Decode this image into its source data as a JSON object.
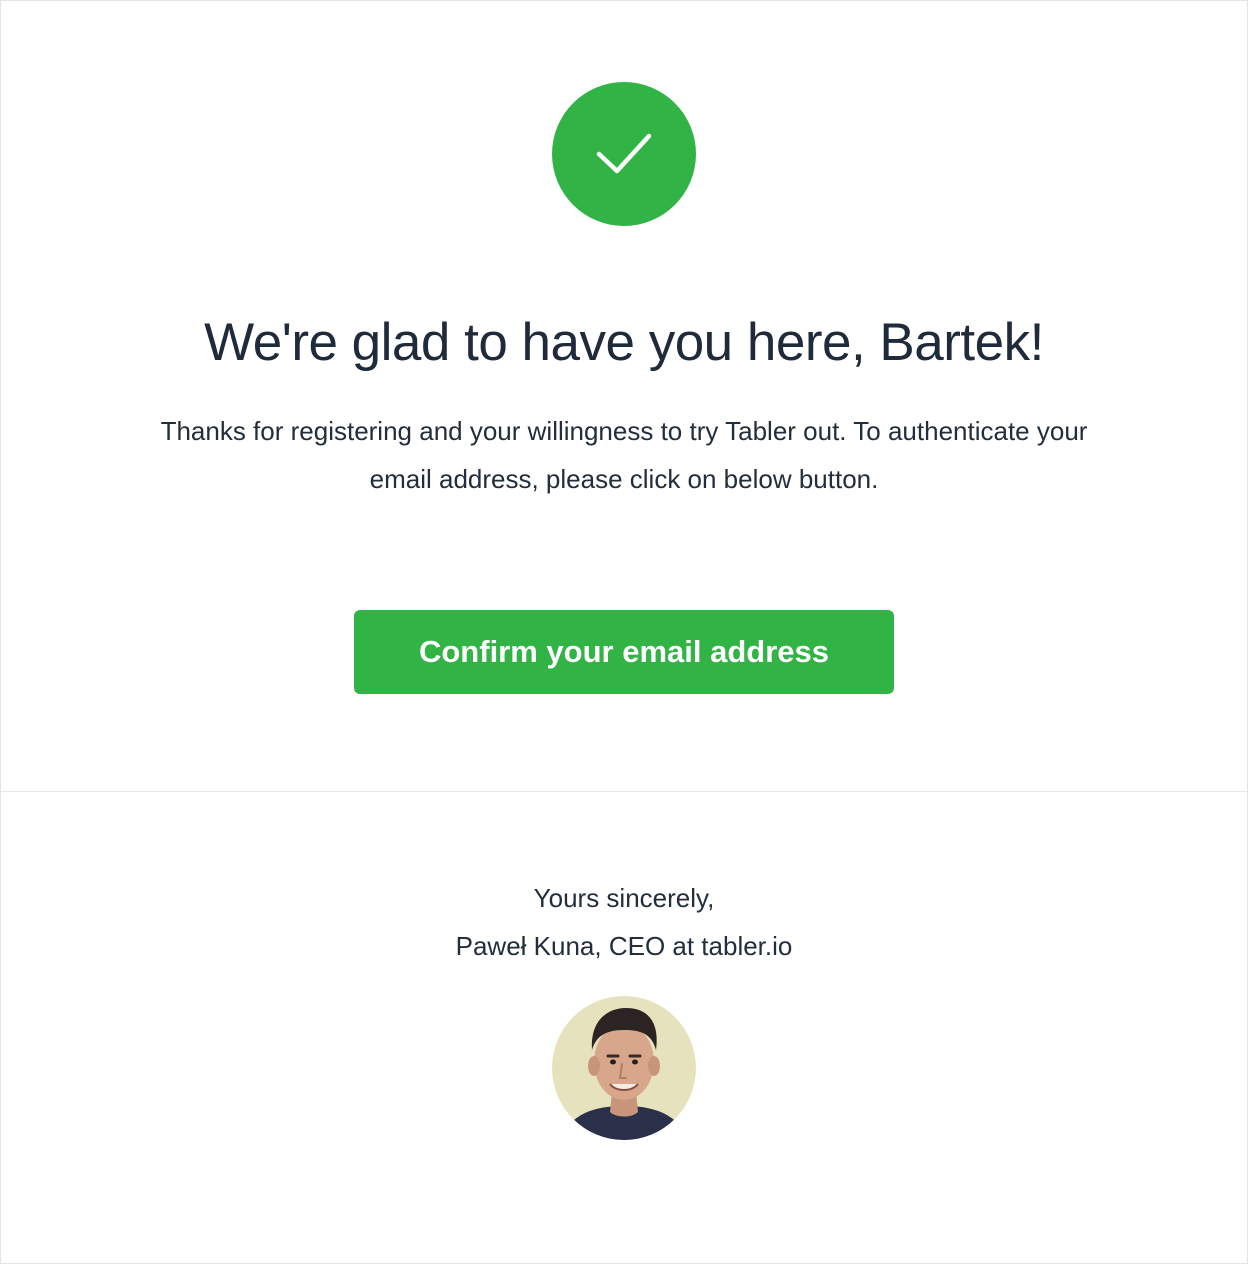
{
  "header": {
    "icon": "check-icon",
    "accent_color": "#31b345"
  },
  "main": {
    "headline": "We're glad to have you here, Bartek!",
    "message_line1": "Thanks for registering and your willingness to try Tabler out. To authenticate your",
    "message_line2": "email address, please click on below button.",
    "confirm_button_label": "Confirm your email address"
  },
  "footer": {
    "closing": "Yours sincerely,",
    "signature": "Paweł Kuna, CEO at tabler.io",
    "avatar_icon": "avatar-photo"
  }
}
